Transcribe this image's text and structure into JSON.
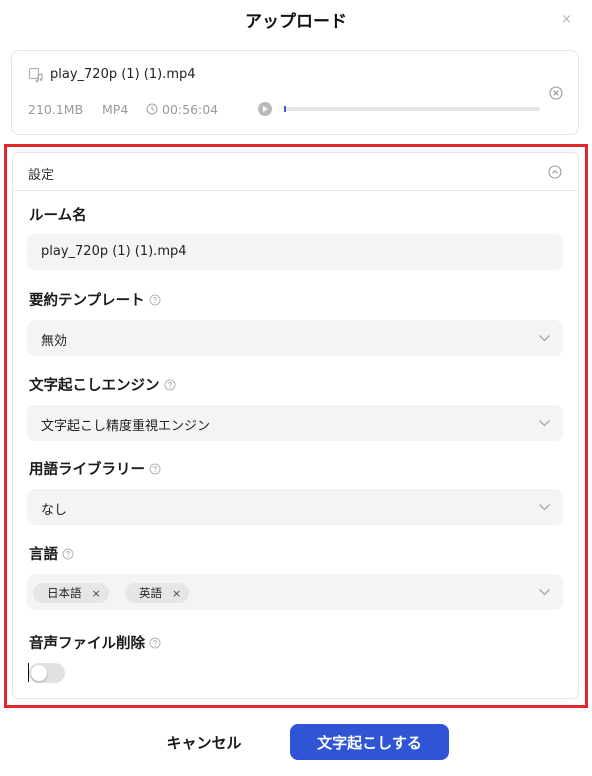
{
  "dialog": {
    "title": "アップロード",
    "close_label": "×"
  },
  "file": {
    "name": "play_720p (1) (1).mp4",
    "size": "210.1MB",
    "format": "MP4",
    "duration": "00:56:04",
    "playback_progress": 0.0
  },
  "settings": {
    "header": "設定",
    "room_name": {
      "label": "ルーム名",
      "value": "play_720p (1) (1).mp4"
    },
    "summary_template": {
      "label": "要約テンプレート",
      "value": "無効"
    },
    "engine": {
      "label": "文字起こしエンジン",
      "value": "文字起こし精度重視エンジン"
    },
    "term_library": {
      "label": "用語ライブラリー",
      "value": "なし"
    },
    "language": {
      "label": "言語",
      "tags": [
        {
          "label": "日本語",
          "remove": "×"
        },
        {
          "label": "英語",
          "remove": "×"
        }
      ]
    },
    "delete_audio": {
      "label": "音声ファイル削除",
      "enabled": false
    }
  },
  "footer": {
    "cancel_label": "キャンセル",
    "submit_label": "文字起こしする"
  },
  "colors": {
    "primary": "#2f55d4",
    "highlight_border": "#e0282e",
    "field_bg": "#f4f4f4"
  },
  "icons": {
    "file": "audio-file-icon",
    "clock": "clock-icon",
    "play": "play-icon",
    "remove": "close-circle-icon",
    "collapse": "chevron-up-circle-icon",
    "help": "question-circle-icon",
    "dropdown": "chevron-down-icon"
  }
}
